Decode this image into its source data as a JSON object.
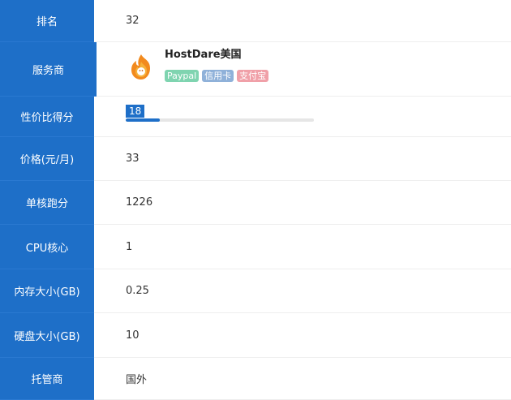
{
  "rows": [
    {
      "label": "排名",
      "value": "32"
    },
    {
      "label": "服务商",
      "value": ""
    },
    {
      "label": "性价比得分",
      "value": "18"
    },
    {
      "label": "价格(元/月)",
      "value": "33"
    },
    {
      "label": "单核跑分",
      "value": "1226"
    },
    {
      "label": "CPU核心",
      "value": "1"
    },
    {
      "label": "内存大小(GB)",
      "value": "0.25"
    },
    {
      "label": "硬盘大小(GB)",
      "value": "10"
    },
    {
      "label": "托管商",
      "value": "国外"
    }
  ],
  "provider": {
    "name": "HostDare美国",
    "logo_icon": "flame-logo-icon",
    "badges": [
      {
        "label": "Paypal",
        "color": "#7fd4b0"
      },
      {
        "label": "信用卡",
        "color": "#8fb1d9"
      },
      {
        "label": "支付宝",
        "color": "#f0a0a8"
      }
    ]
  },
  "score": {
    "value": "18",
    "fraction": 0.18
  },
  "colors": {
    "label_bg": "#1e6fc8",
    "accent": "#1e6fc8"
  }
}
